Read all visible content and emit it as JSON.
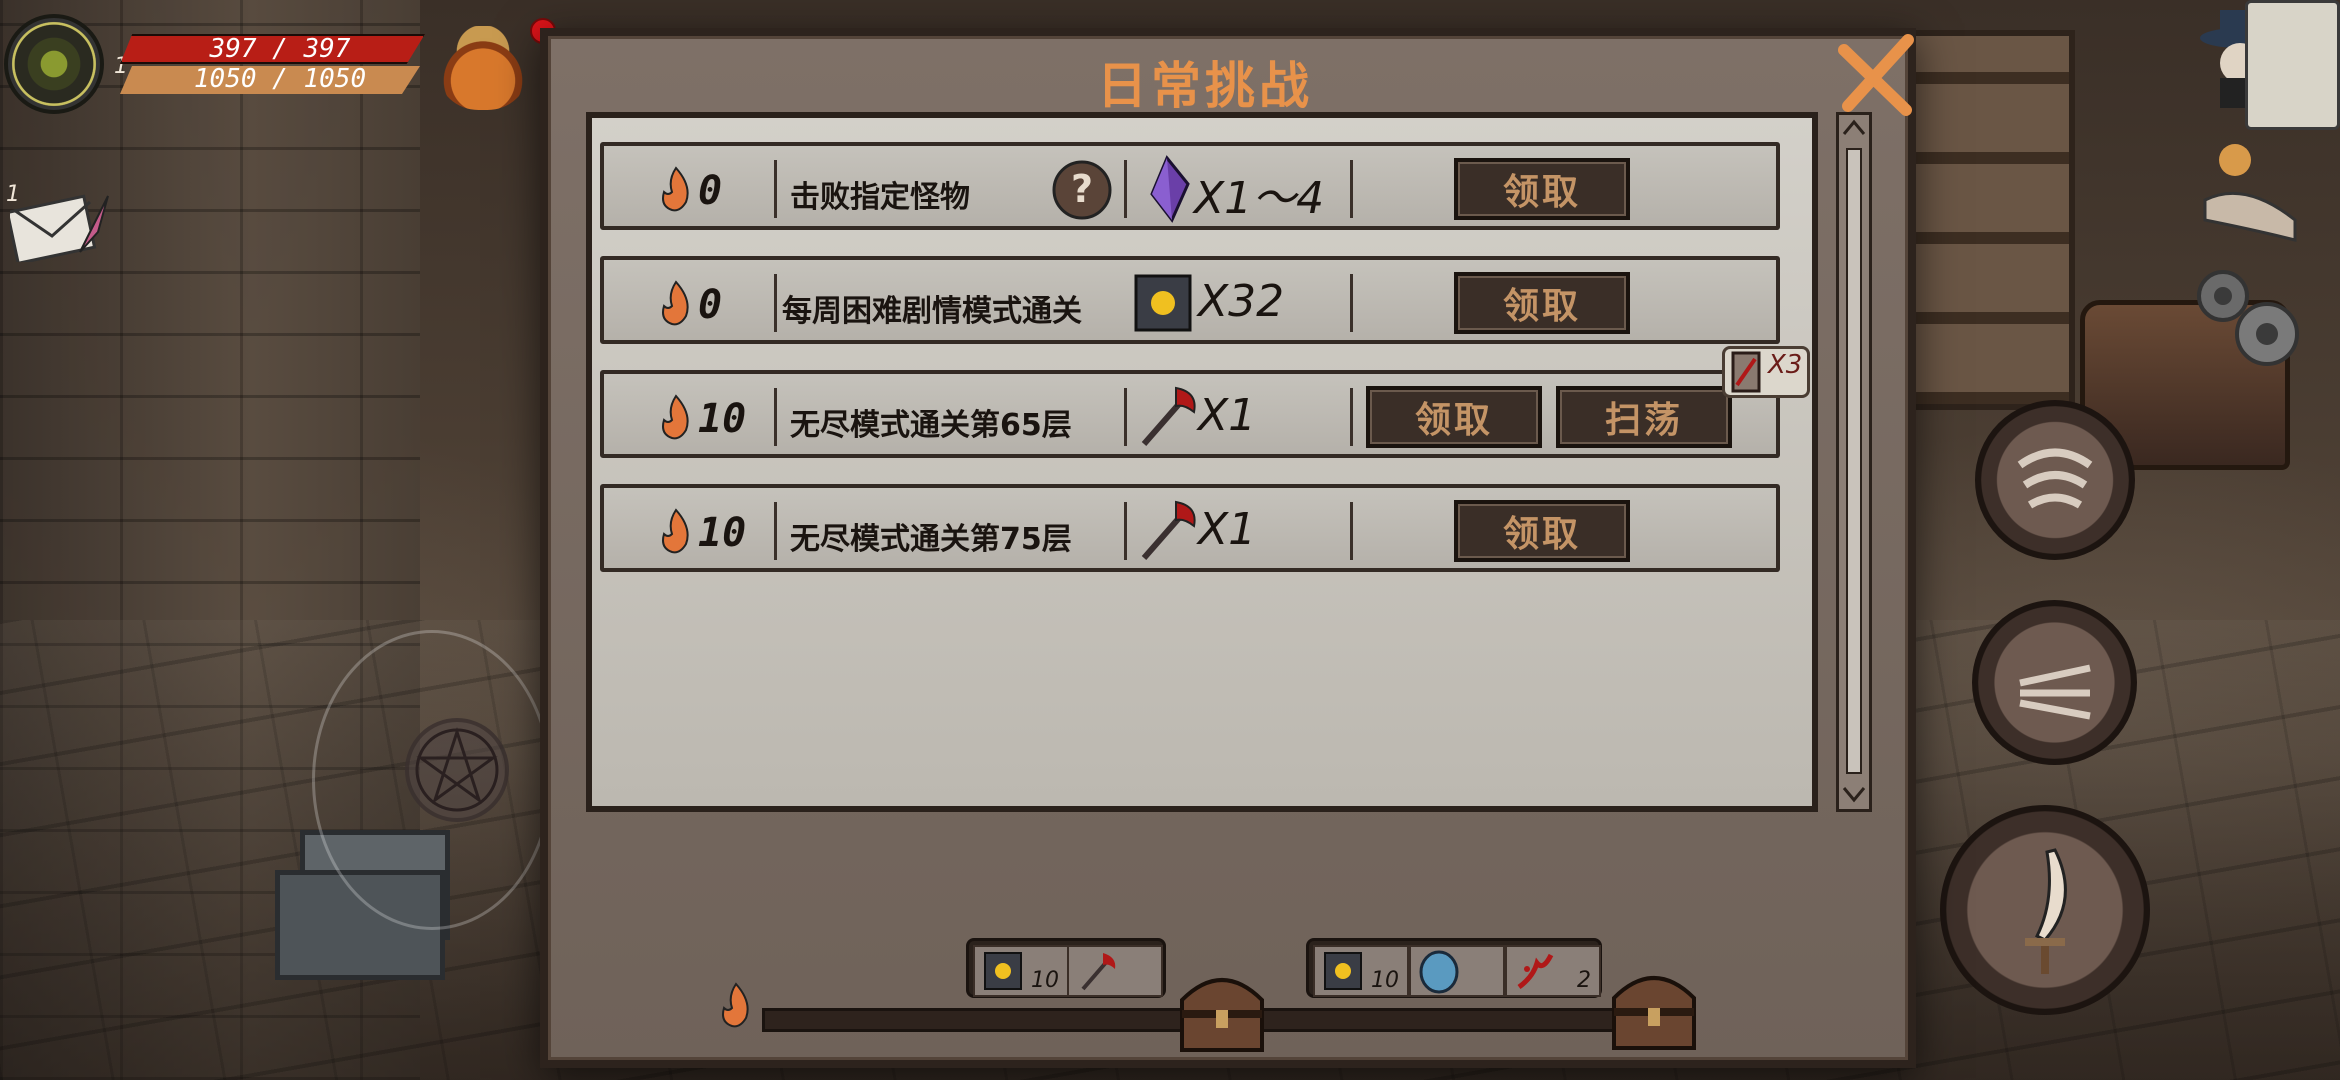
{
  "hud": {
    "level": "1",
    "hp_text": "397 / 397",
    "mp_text": "1050 / 1050",
    "mail_count": "1"
  },
  "panel": {
    "title": "日常挑战",
    "claim_label": "领取",
    "sweep_label": "扫荡"
  },
  "challenges": [
    {
      "points": "0",
      "task": "击败指定怪物",
      "reward_icon": "purple-crystal-icon",
      "reward_qty": "X1～4",
      "has_sweep": false
    },
    {
      "points": "0",
      "task": "每周困难剧情模式通关",
      "reward_icon": "glowing-cube-icon",
      "reward_qty": "X32",
      "has_sweep": false
    },
    {
      "points": "10",
      "task": "无尽模式通关第65层",
      "reward_icon": "blood-axe-icon",
      "reward_qty": "X1",
      "has_sweep": true
    },
    {
      "points": "10",
      "task": "无尽模式通关第75层",
      "reward_icon": "blood-axe-icon",
      "reward_qty": "X1",
      "has_sweep": false
    }
  ],
  "sweep_tickets": {
    "text": "X3"
  },
  "milestones": {
    "progress": 0,
    "groups": [
      {
        "rewards": [
          {
            "icon": "glowing-cube-icon",
            "qty": "10"
          },
          {
            "icon": "blood-axe-icon",
            "qty": ""
          }
        ]
      },
      {
        "rewards": [
          {
            "icon": "glowing-cube-icon",
            "qty": "10"
          },
          {
            "icon": "blue-shield-icon",
            "qty": ""
          },
          {
            "icon": "blood-splatter-icon",
            "qty": "2"
          }
        ]
      }
    ]
  },
  "colors": {
    "title": "#e8924a",
    "button_text": "#c49466",
    "hp": "#b81e16",
    "mp": "#c98a50",
    "progress": "#e9844a"
  }
}
